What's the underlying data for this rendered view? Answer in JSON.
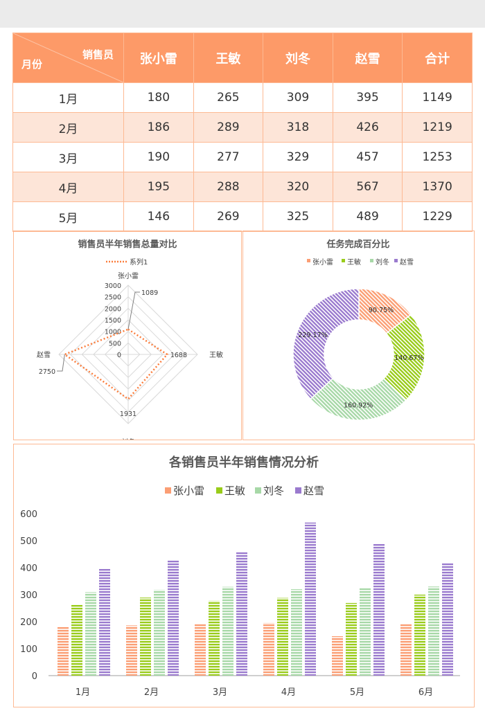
{
  "table": {
    "corner_top": "销售员",
    "corner_bottom": "月份",
    "headers": [
      "张小雷",
      "王敏",
      "刘冬",
      "赵雪",
      "合计"
    ],
    "rows": [
      [
        "1月",
        "180",
        "265",
        "309",
        "395",
        "1149"
      ],
      [
        "2月",
        "186",
        "289",
        "318",
        "426",
        "1219"
      ],
      [
        "3月",
        "190",
        "277",
        "329",
        "457",
        "1253"
      ],
      [
        "4月",
        "195",
        "288",
        "320",
        "567",
        "1370"
      ],
      [
        "5月",
        "146",
        "269",
        "325",
        "489",
        "1229"
      ]
    ]
  },
  "colors": {
    "header": "#fd9a68",
    "alt_row": "#fde5d8",
    "zhang": "#fb9e74",
    "wang": "#99cc1a",
    "liu": "#a7d8a7",
    "zhao": "#9a7ace"
  },
  "chart_data": [
    {
      "type": "radar",
      "title": "销售员半年销售总量对比",
      "legend": [
        "系列1"
      ],
      "categories": [
        "张小雷",
        "王敏",
        "刘冬",
        "赵雪"
      ],
      "values": [
        1089,
        1688,
        1931,
        2750
      ],
      "ticks": [
        "0",
        "500",
        "1000",
        "1500",
        "2000",
        "2500",
        "3000"
      ],
      "rlim": [
        0,
        3000
      ],
      "labels": [
        "1089",
        "1688",
        "1931",
        "2750"
      ]
    },
    {
      "type": "pie",
      "title": "任务完成百分比",
      "legend": [
        "张小雷",
        "王敏",
        "刘冬",
        "赵雪"
      ],
      "values": [
        90.75,
        140.67,
        160.92,
        229.17
      ],
      "labels": [
        "90.75%",
        "140.67%",
        "160.92%",
        "229.17%"
      ]
    },
    {
      "type": "bar",
      "title": "各销售员半年销售情况分析",
      "categories": [
        "1月",
        "2月",
        "3月",
        "4月",
        "5月",
        "6月"
      ],
      "series": [
        {
          "name": "张小雷",
          "values": [
            180,
            186,
            190,
            195,
            146,
            192
          ]
        },
        {
          "name": "王敏",
          "values": [
            265,
            289,
            277,
            288,
            269,
            300
          ]
        },
        {
          "name": "刘冬",
          "values": [
            309,
            318,
            329,
            320,
            325,
            330
          ]
        },
        {
          "name": "赵雪",
          "values": [
            395,
            426,
            457,
            567,
            489,
            416
          ]
        }
      ],
      "ylim": [
        0,
        600
      ],
      "yticks": [
        "0",
        "100",
        "200",
        "300",
        "400",
        "500",
        "600"
      ],
      "grid": false,
      "legend_position": "top"
    }
  ]
}
